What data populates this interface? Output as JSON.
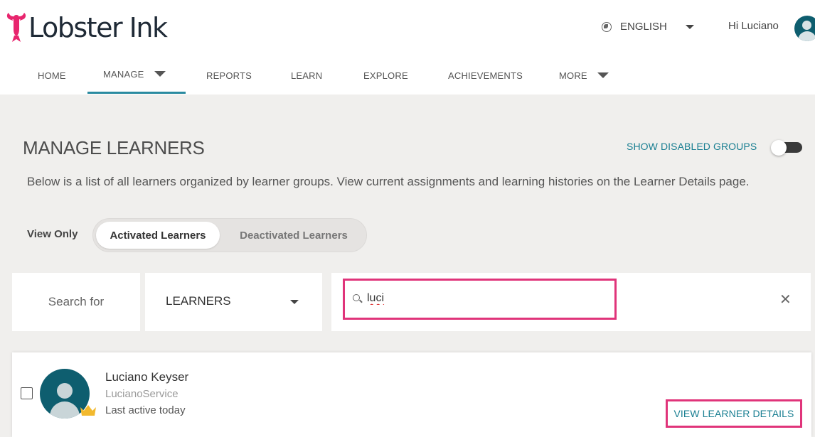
{
  "brand": {
    "name": "Lobster Ink",
    "logo_color": "#e8256e"
  },
  "header": {
    "language": "ENGLISH",
    "greeting": "Hi Luciano"
  },
  "nav": {
    "items": [
      "HOME",
      "MANAGE",
      "REPORTS",
      "LEARN",
      "EXPLORE",
      "ACHIEVEMENTS",
      "MORE"
    ],
    "active": "MANAGE"
  },
  "page": {
    "title": "MANAGE LEARNERS",
    "show_disabled_label": "SHOW DISABLED GROUPS",
    "show_disabled_on": false,
    "description": "Below is a list of all learners organized by learner groups. View current assignments and learning histories on the Learner Details page."
  },
  "filter": {
    "view_only_label": "View Only",
    "options": [
      "Activated Learners",
      "Deactivated Learners"
    ],
    "selected": "Activated Learners"
  },
  "search": {
    "label": "Search for",
    "type": "LEARNERS",
    "query": "luci",
    "clear_icon": "close-icon"
  },
  "learners": [
    {
      "name": "Luciano Keyser",
      "username": "LucianoService",
      "last_active": "Last active today",
      "action": "VIEW LEARNER DETAILS"
    }
  ],
  "colors": {
    "accent": "#1a7f92",
    "highlight": "#e0347a",
    "avatar": "#0e5e6f",
    "crown": "#f2b92e"
  }
}
